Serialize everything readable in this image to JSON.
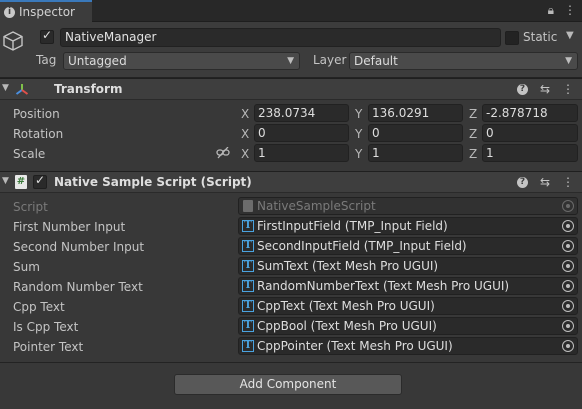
{
  "tab": {
    "label": "Inspector"
  },
  "object": {
    "name": "NativeManager",
    "active": true,
    "static_label": "Static",
    "tag_label": "Tag",
    "tag_value": "Untagged",
    "layer_label": "Layer",
    "layer_value": "Default"
  },
  "transform": {
    "title": "Transform",
    "rows": [
      {
        "label": "Position",
        "x": "238.0734",
        "y": "136.0291",
        "z": "-2.878718"
      },
      {
        "label": "Rotation",
        "x": "0",
        "y": "0",
        "z": "0"
      },
      {
        "label": "Scale",
        "x": "1",
        "y": "1",
        "z": "1"
      }
    ],
    "axes": [
      "X",
      "Y",
      "Z"
    ]
  },
  "script_component": {
    "title": "Native Sample Script (Script)",
    "script_label": "Script",
    "script_value": "NativeSampleScript",
    "fields": [
      {
        "label": "First Number Input",
        "value": "FirstInputField (TMP_Input Field)"
      },
      {
        "label": "Second Number Input",
        "value": "SecondInputField (TMP_Input Field)"
      },
      {
        "label": "Sum",
        "value": "SumText (Text Mesh Pro UGUI)"
      },
      {
        "label": "Random Number Text",
        "value": "RandomNumberText (Text Mesh Pro UGUI)"
      },
      {
        "label": "Cpp Text",
        "value": "CppText (Text Mesh Pro UGUI)"
      },
      {
        "label": "Is Cpp Text",
        "value": "CppBool (Text Mesh Pro UGUI)"
      },
      {
        "label": "Pointer Text",
        "value": "CppPointer (Text Mesh Pro UGUI)"
      }
    ]
  },
  "add_component_label": "Add Component",
  "colors": {
    "accent": "#3a79bb",
    "object_ref_icon": "#4aa3e0",
    "background": "#383838"
  }
}
